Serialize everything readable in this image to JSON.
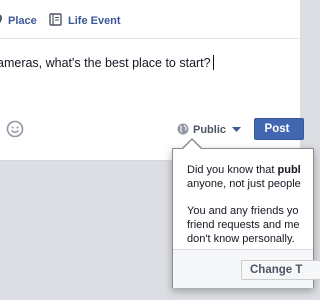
{
  "tabs": [
    {
      "label": "Place",
      "icon": "place-pin-icon"
    },
    {
      "label": "Life Event",
      "icon": "life-event-book-icon"
    }
  ],
  "composer": {
    "text": "ameras, what's the best place to start?"
  },
  "footer": {
    "emoji_icon": "smiley-icon",
    "audience_label": "Public",
    "audience_icon": "globe-icon",
    "post_label": "Post"
  },
  "popover": {
    "p1_prefix": "Did you know that ",
    "p1_bold": "publ",
    "p1_line2": "anyone, not just people",
    "p2_line1": "You and any friends yo",
    "p2_line2": "friend requests and me",
    "p2_line3": "don't know personally.",
    "button_label": "Change T"
  },
  "colors": {
    "link_blue": "#3b5998",
    "post_button": "#4267b2",
    "page_bg": "#dcdee3"
  }
}
